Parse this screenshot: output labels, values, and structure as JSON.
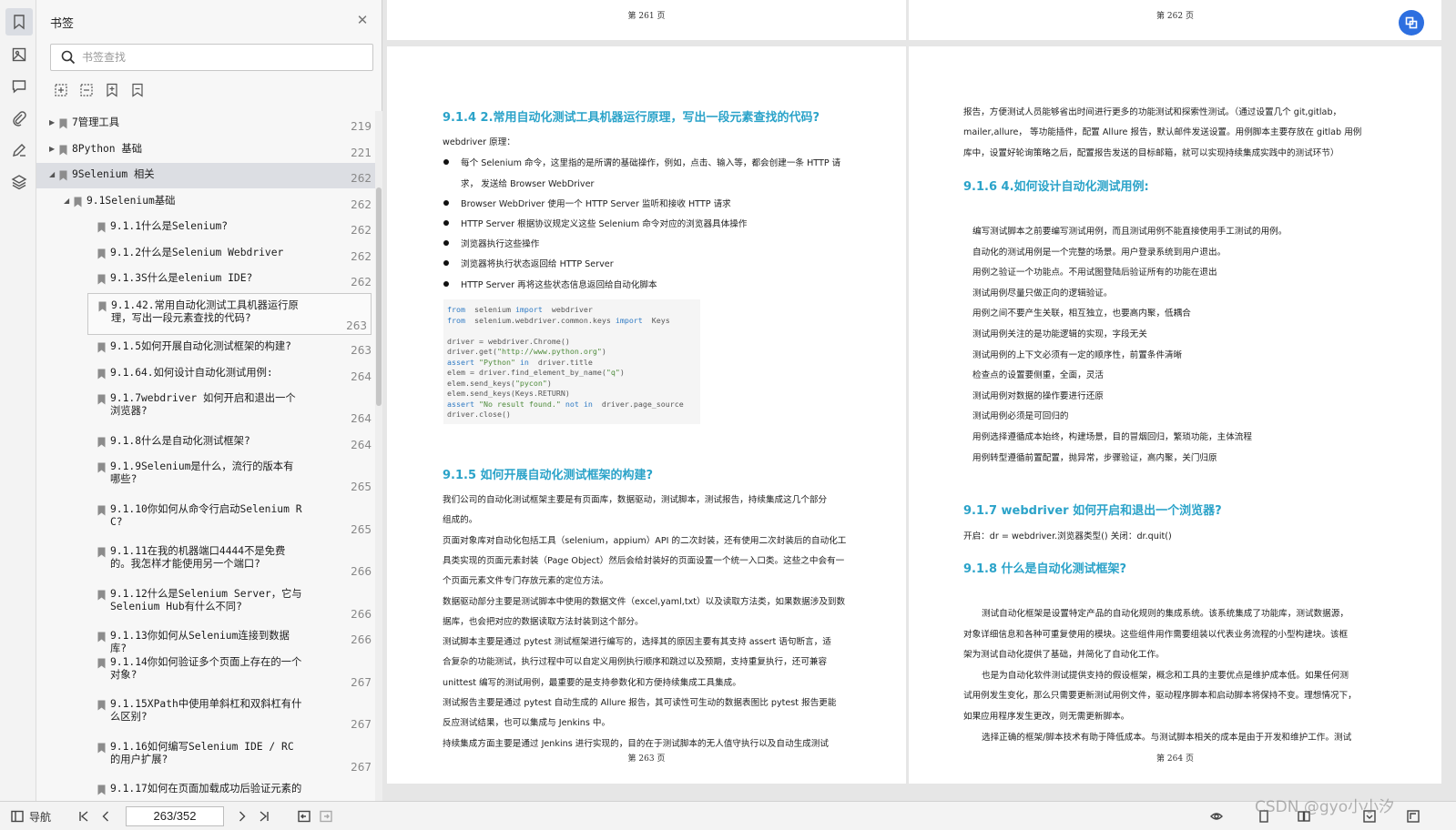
{
  "panel": {
    "title": "书签",
    "close_icon": "close-icon",
    "search_placeholder": "书签查找"
  },
  "tree": [
    {
      "label": "7管理工具",
      "page": "219",
      "level": 0,
      "caret": "▶"
    },
    {
      "label": "8Python 基础",
      "page": "221",
      "level": 0,
      "caret": "▶"
    },
    {
      "label": "9Selenium 相关",
      "page": "262",
      "level": 0,
      "caret": "◢",
      "selected": true
    },
    {
      "label": "9.1Selenium基础",
      "page": "262",
      "level": 1,
      "caret": "◢"
    },
    {
      "label": "9.1.1什么是Selenium?",
      "page": "262",
      "level": 2
    },
    {
      "label": "9.1.2什么是Selenium  Webdriver",
      "page": "262",
      "level": 2
    },
    {
      "label": "9.1.3S什么是elenium IDE?",
      "page": "262",
      "level": 2
    },
    {
      "label": "9.1.42.常用自动化测试工具机器运行原理，写出一段元素查找的代码?",
      "page": "263",
      "level": 2,
      "framed": true
    },
    {
      "label": "9.1.5如何开展自动化测试框架的构建?",
      "page": "263",
      "level": 2
    },
    {
      "label": "9.1.64.如何设计自动化测试用例:",
      "page": "264",
      "level": 2
    },
    {
      "label": "9.1.7webdriver 如何开启和退出一个浏览器?",
      "page": "264",
      "level": 2
    },
    {
      "label": "9.1.8什么是自动化测试框架?",
      "page": "264",
      "level": 2
    },
    {
      "label": "9.1.9Selenium是什么，流行的版本有哪些?",
      "page": "265",
      "level": 2
    },
    {
      "label": "9.1.10你如何从命令行启动Selenium RC?",
      "page": "265",
      "level": 2
    },
    {
      "label": "9.1.11在我的机器端口4444不是免费的。我怎样才能使用另一个端口?",
      "page": "266",
      "level": 2
    },
    {
      "label": "9.1.12什么是Selenium Server，它与Selenium Hub有什么不同?",
      "page": "266",
      "level": 2
    },
    {
      "label": "9.1.13你如何从Selenium连接到数据库?",
      "page": "266",
      "level": 2
    },
    {
      "label": "9.1.14你如何验证多个页面上存在的一个对象?",
      "page": "267",
      "level": 2
    },
    {
      "label": "9.1.15XPath中使用单斜杠和双斜杠有什么区别?",
      "page": "267",
      "level": 2
    },
    {
      "label": "9.1.16如何编写Selenium IDE / RC的用户扩展?",
      "page": "267",
      "level": 2
    },
    {
      "label": "9.1.17如何在页面加载成功后验证元素的",
      "page": "",
      "level": 2
    }
  ],
  "pages": {
    "p261_header": "第 261 页",
    "p262_header": "第 262 页",
    "p263_footer": "第 263 页",
    "p264_footer": "第 264 页"
  },
  "left_page": {
    "s914_title": "9.1.4  2.常用自动化测试工具机器运行原理，写出一段元素查找的代码?",
    "wd_principle": "webdriver 原理：",
    "bullets": [
      "每个 Selenium 命令，这里指的是所谓的基础操作，例如，点击、输入等，都会创建一条 HTTP 请",
      "求，  发送给 Browser WebDriver",
      "Browser WebDriver 使用一个 HTTP Server 监听和接收 HTTP  请求",
      "HTTP Server 根据协议规定义这些 Selenium 命令对应的浏览器具体操作",
      "浏览器执行这些操作",
      "浏览器将执行状态返回给 HTTP Server",
      "HTTP Server 再将这些状态信息返回给自动化脚本"
    ],
    "code": [
      {
        "parts": [
          [
            "kw",
            "from"
          ],
          [
            "",
            "  selenium "
          ],
          [
            "kw",
            "import"
          ],
          [
            "",
            "  webdriver"
          ]
        ]
      },
      {
        "parts": [
          [
            "kw",
            "from"
          ],
          [
            "",
            "  selenium.webdriver.common.keys "
          ],
          [
            "kw",
            "import"
          ],
          [
            "",
            "  Keys"
          ]
        ]
      },
      {
        "parts": [
          [
            "",
            ""
          ]
        ]
      },
      {
        "parts": [
          [
            "",
            "driver = webdriver.Chrome()"
          ]
        ]
      },
      {
        "parts": [
          [
            "",
            "driver.get("
          ],
          [
            "str",
            "\"http://www.python.org\""
          ],
          [
            "",
            ")"
          ]
        ]
      },
      {
        "parts": [
          [
            "kw",
            "assert"
          ],
          [
            "str",
            " \"Python\" "
          ],
          [
            "kw",
            "in"
          ],
          [
            "",
            "  driver.title"
          ]
        ]
      },
      {
        "parts": [
          [
            "",
            "elem = driver.find_element_by_name("
          ],
          [
            "str",
            "\"q\""
          ],
          [
            "",
            ")"
          ]
        ]
      },
      {
        "parts": [
          [
            "",
            "elem.send_keys("
          ],
          [
            "str",
            "\"pycon\""
          ],
          [
            "",
            ")"
          ]
        ]
      },
      {
        "parts": [
          [
            "",
            "elem.send_keys(Keys.RETURN)"
          ]
        ]
      },
      {
        "parts": [
          [
            "kw",
            "assert"
          ],
          [
            "str",
            " \"No result found.\" "
          ],
          [
            "kw",
            "not in"
          ],
          [
            "",
            "  driver.page_source"
          ]
        ]
      },
      {
        "parts": [
          [
            "",
            "driver.close()"
          ]
        ]
      }
    ],
    "s915_title": "9.1.5  如何开展自动化测试框架的构建?",
    "s915_lines": [
      "我们公司的自动化测试框架主要是有页面库，数据驱动，测试脚本，测试报告，持续集成这几个部分",
      "组成的。",
      "页面对象库对自动化包括工具（selenium，appium）API 的二次封装，还有使用二次封装后的自动化工",
      "具类实现的页面元素封装（Page Object）然后会给封装好的页面设置一个统一入口类。这些之中会有一",
      "个页面元素文件专门存放元素的定位方法。",
      "数据驱动部分主要是测试脚本中使用的数据文件（excel,yaml,txt）以及读取方法类，如果数据涉及到数",
      "据库，也会把对应的数据读取方法封装到这个部分。",
      "测试脚本主要是通过  pytest  测试框架进行编写的，选择其的原因主要有其支持  assert  语句断言，适",
      "合复杂的功能测试，执行过程中可以自定义用例执行顺序和跳过以及预期，支持重复执行，还可兼容",
      "unittest 编写的测试用例，最重要的是支持参数化和方便持续集成工具集成。",
      "测试报告主要是通过  pytest  自动生成的 Allure 报告，其可读性可生动的数据表图比  pytest  报告更能",
      "反应测试结果，也可以集成与  Jenkins  中。",
      "持续集成方面主要是通过 Jenkins 进行实现的，目的在于测试脚本的无人值守执行以及自动生成测试"
    ]
  },
  "right_page": {
    "top_lines": [
      "报告，方便测试人员能够省出时间进行更多的功能测试和探索性测试。（通过设置几个  git,gitlab，",
      "mailer,allure，   等功能插件，配置  Allure  报告，默认邮件发送设置。用例脚本主要存放在  gitlab  用例",
      "库中，设置好轮询策略之后，配置报告发送的目标邮箱，就可以实现持续集成实践中的测试环节）"
    ],
    "s916_title": "9.1.6  4.如何设计自动化测试用例:",
    "s916_lines": [
      "编写测试脚本之前要编写测试用例，而且测试用例不能直接使用手工测试的用例。",
      "自动化的测试用例是一个完整的场景。用户登录系统到用户退出。",
      "用例之验证一个功能点。不用试图登陆后验证所有的功能在退出",
      "测试用例尽量只做正向的逻辑验证。",
      "用例之间不要产生关联，相互独立，也要高内聚，低耦合",
      "测试用例关注的是功能逻辑的实现，字段无关",
      "测试用例的上下文必须有一定的顺序性，前置条件清晰",
      "检查点的设置要侧重，全面，灵活",
      "测试用例对数据的操作要进行还原",
      "测试用例必须是可回归的",
      "用例选择遵循成本始终，构建场景，目的冒烟回归，繁琐功能，主体流程",
      "用例转型遵循前置配置，抛异常，步骤验证，高内聚，关门归原"
    ],
    "s917_title": "9.1.7  webdriver  如何开启和退出一个浏览器?",
    "s917_line": "开启：dr = webdriver.浏览器类型()  关闭：dr.quit()",
    "s918_title": "9.1.8  什么是自动化测试框架?",
    "s918_lines": [
      "测试自动化框架是设置特定产品的自动化规则的集成系统。该系统集成了功能库，测试数据源，",
      "对象详细信息和各种可重复使用的模块。这些组件用作需要组装以代表业务流程的小型构建块。该框",
      "架为测试自动化提供了基础，并简化了自动化工作。",
      "也是为自动化软件测试提供支持的假设框架，概念和工具的主要优点是维护成本低。如果任何测",
      "试用例发生变化，那么只需要更新测试用例文件，驱动程序脚本和启动脚本将保持不变。理想情况下，",
      "如果应用程序发生更改，则无需更新脚本。",
      "选择正确的框架/脚本技术有助于降低成本。与测试脚本相关的成本是由于开发和维护工作。测试"
    ]
  },
  "bottombar": {
    "nav_label": "导航",
    "page_indicator": "263/352",
    "watermark": "CSDN @gyo小小汐"
  },
  "colors": {
    "accent": "#2ba3c9",
    "float_button": "#2d6fe0"
  }
}
